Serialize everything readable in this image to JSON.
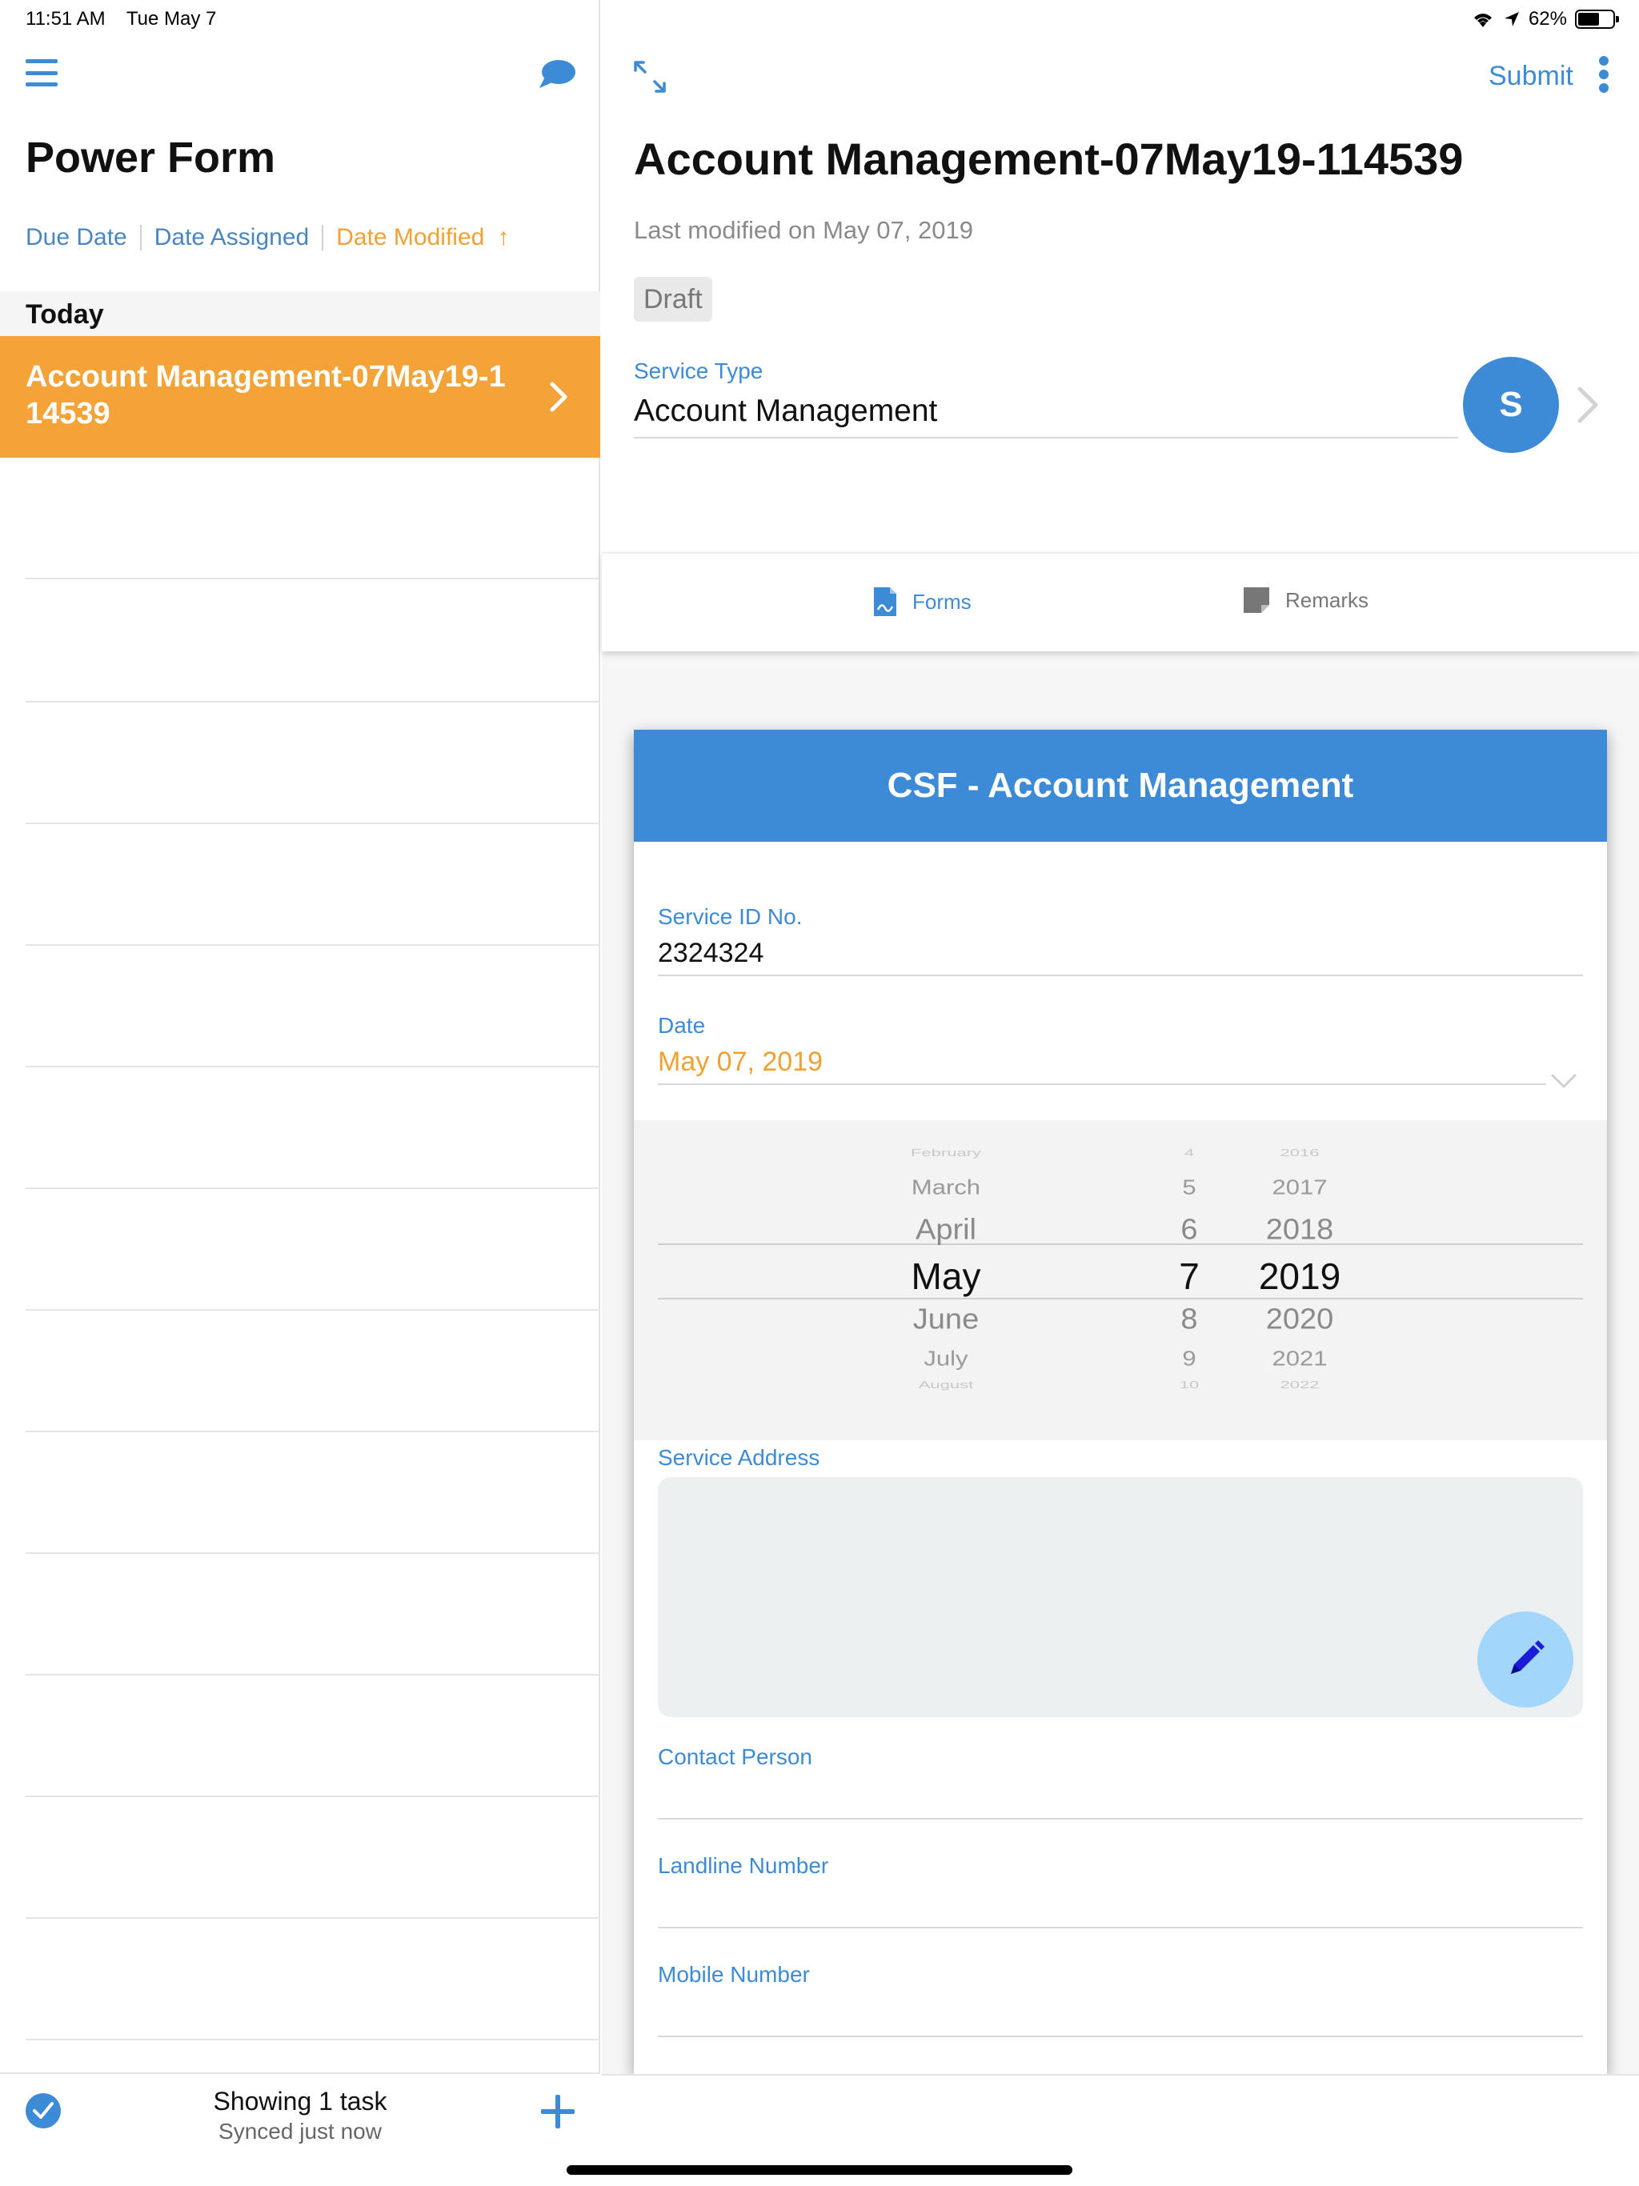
{
  "status": {
    "time": "11:51 AM",
    "date": "Tue May 7",
    "battery": "62%",
    "battery_level": 0.62
  },
  "left": {
    "title": "Power Form",
    "sort": {
      "due_date": "Due Date",
      "date_assigned": "Date Assigned",
      "date_modified": "Date Modified",
      "arrow": "↑"
    },
    "section": "Today",
    "task_title": "Account Management-07May19-1 14539",
    "footer": {
      "title": "Showing 1 task",
      "subtitle": "Synced just now"
    }
  },
  "right": {
    "submit": "Submit",
    "doc_title": "Account Management-07May19-114539",
    "last_modified": "Last modified on May 07, 2019",
    "status_badge": "Draft",
    "service_type_label": "Service Type",
    "service_type_value": "Account Management",
    "avatar_letter": "S",
    "tabs": {
      "forms": "Forms",
      "remarks": "Remarks"
    },
    "form": {
      "title": "CSF - Account Management",
      "service_id_label": "Service ID No.",
      "service_id_value": "2324324",
      "date_label": "Date",
      "date_value": "May 07, 2019",
      "picker": {
        "months": [
          "February",
          "March",
          "April",
          "May",
          "June",
          "July",
          "August"
        ],
        "days": [
          "4",
          "5",
          "6",
          "7",
          "8",
          "9",
          "10"
        ],
        "years": [
          "2016",
          "2017",
          "2018",
          "2019",
          "2020",
          "2021",
          "2022"
        ]
      },
      "service_address_label": "Service Address",
      "contact_person_label": "Contact Person",
      "landline_label": "Landline Number",
      "mobile_label": "Mobile Number"
    }
  },
  "colors": {
    "accent": "#3d8bd6",
    "orange": "#f4a338",
    "orange_text": "#f0a132"
  },
  "icons": [
    "hamburger-menu-icon",
    "chat-bubble-icon",
    "chevron-right-icon",
    "check-circle-icon",
    "plus-icon",
    "expand-icon",
    "more-vertical-icon",
    "forms-document-icon",
    "remarks-note-icon",
    "pencil-icon",
    "chevron-down-icon",
    "wifi-icon",
    "location-arrow-icon",
    "battery-icon"
  ]
}
